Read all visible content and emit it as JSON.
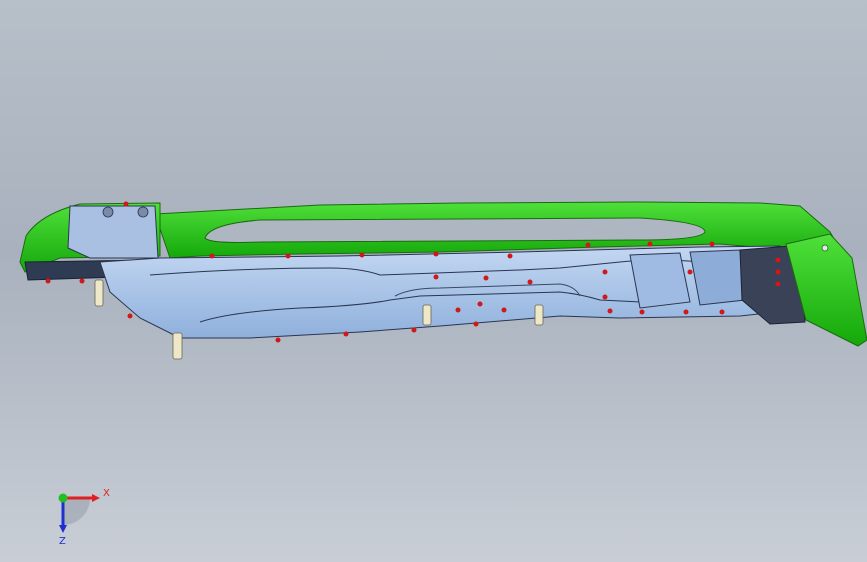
{
  "viewport": {
    "colors": {
      "background_top": "#b7bfc9",
      "background_bottom": "#c9ced6",
      "part_blue": "#a8c4ea",
      "part_green": "#22c412",
      "fixture_pin": "#eee8c8",
      "weld_point": "#d01818"
    }
  },
  "triad": {
    "x_label": "X",
    "z_label": "Z",
    "x_color": "#e02020",
    "y_color": "#20c020",
    "z_color": "#2030d0"
  }
}
